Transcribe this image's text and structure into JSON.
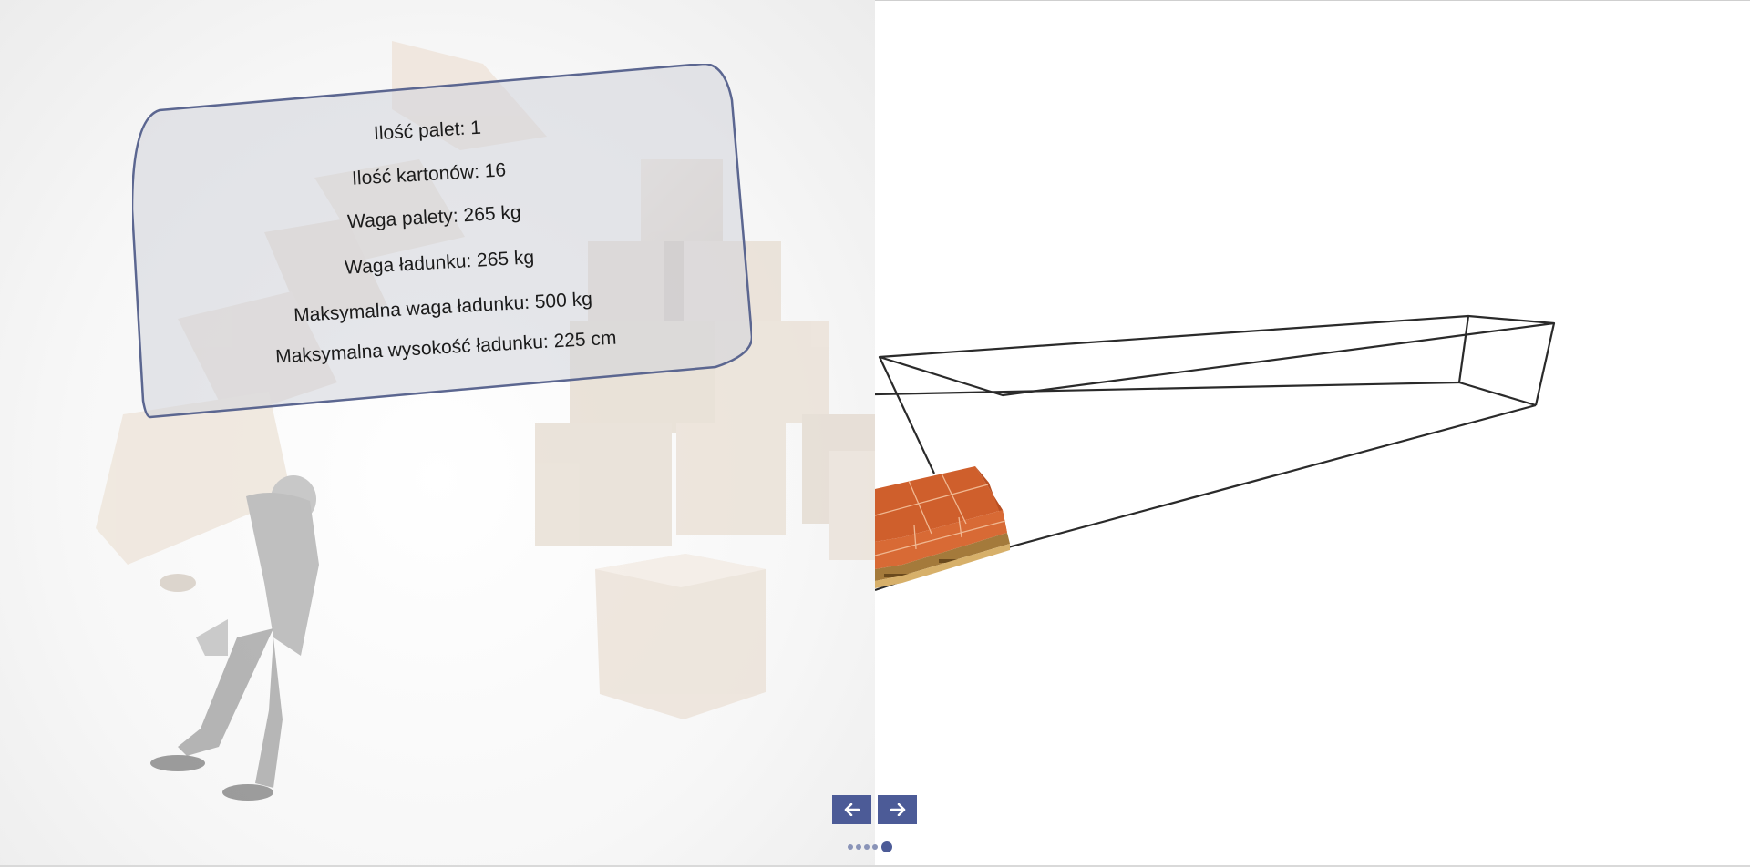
{
  "info": {
    "pallet_count": "Ilość palet: 1",
    "carton_count": "Ilość kartonów: 16",
    "pallet_weight": "Waga palety: 265 kg",
    "load_weight": "Waga ładunku: 265 kg",
    "max_load_weight": "Maksymalna waga ładunku: 500 kg",
    "max_load_height": "Maksymalna wysokość ładunku: 225 cm"
  },
  "navigation": {
    "prev_icon": "arrow-left-icon",
    "next_icon": "arrow-right-icon",
    "dots_count": 5,
    "active_dot": 5
  },
  "colors": {
    "accent": "#4c5b97",
    "cargo": "#d2622e",
    "card_border": "#5b6690"
  }
}
